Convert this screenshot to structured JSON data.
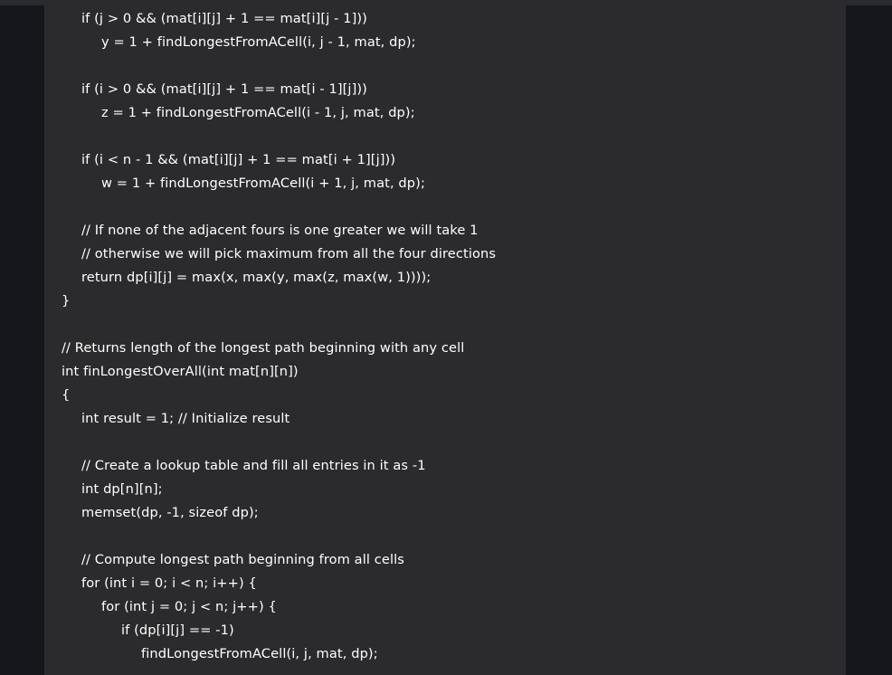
{
  "code": {
    "lines": [
      {
        "indent": 1,
        "text": "if (j > 0 && (mat[i][j] + 1 == mat[i][j - 1]))"
      },
      {
        "indent": 2,
        "text": "y = 1 + findLongestFromACell(i, j - 1, mat, dp);"
      },
      {
        "indent": 0,
        "text": ""
      },
      {
        "indent": 1,
        "text": "if (i > 0 && (mat[i][j] + 1 == mat[i - 1][j]))"
      },
      {
        "indent": 2,
        "text": "z = 1 + findLongestFromACell(i - 1, j, mat, dp);"
      },
      {
        "indent": 0,
        "text": ""
      },
      {
        "indent": 1,
        "text": "if (i < n - 1 && (mat[i][j] + 1 == mat[i + 1][j]))"
      },
      {
        "indent": 2,
        "text": "w = 1 + findLongestFromACell(i + 1, j, mat, dp);"
      },
      {
        "indent": 0,
        "text": ""
      },
      {
        "indent": 1,
        "text": "// If none of the adjacent fours is one greater we will take 1"
      },
      {
        "indent": 1,
        "text": "// otherwise we will pick maximum from all the four directions"
      },
      {
        "indent": 1,
        "text": "return dp[i][j] = max(x, max(y, max(z, max(w, 1))));"
      },
      {
        "indent": 0,
        "text": "}"
      },
      {
        "indent": 0,
        "text": ""
      },
      {
        "indent": 0,
        "text": "// Returns length of the longest path beginning with any cell"
      },
      {
        "indent": 0,
        "text": "int finLongestOverAll(int mat[n][n])"
      },
      {
        "indent": 0,
        "text": "{"
      },
      {
        "indent": 1,
        "text": "int result = 1; // Initialize result"
      },
      {
        "indent": 0,
        "text": ""
      },
      {
        "indent": 1,
        "text": "// Create a lookup table and fill all entries in it as -1"
      },
      {
        "indent": 1,
        "text": "int dp[n][n];"
      },
      {
        "indent": 1,
        "text": "memset(dp, -1, sizeof dp);"
      },
      {
        "indent": 0,
        "text": ""
      },
      {
        "indent": 1,
        "text": "// Compute longest path beginning from all cells"
      },
      {
        "indent": 1,
        "text": "for (int i = 0; i < n; i++) {"
      },
      {
        "indent": 2,
        "text": "for (int j = 0; j < n; j++) {"
      },
      {
        "indent": 3,
        "text": "if (dp[i][j] == -1)"
      },
      {
        "indent": 4,
        "text": "findLongestFromACell(i, j, mat, dp);"
      }
    ]
  }
}
